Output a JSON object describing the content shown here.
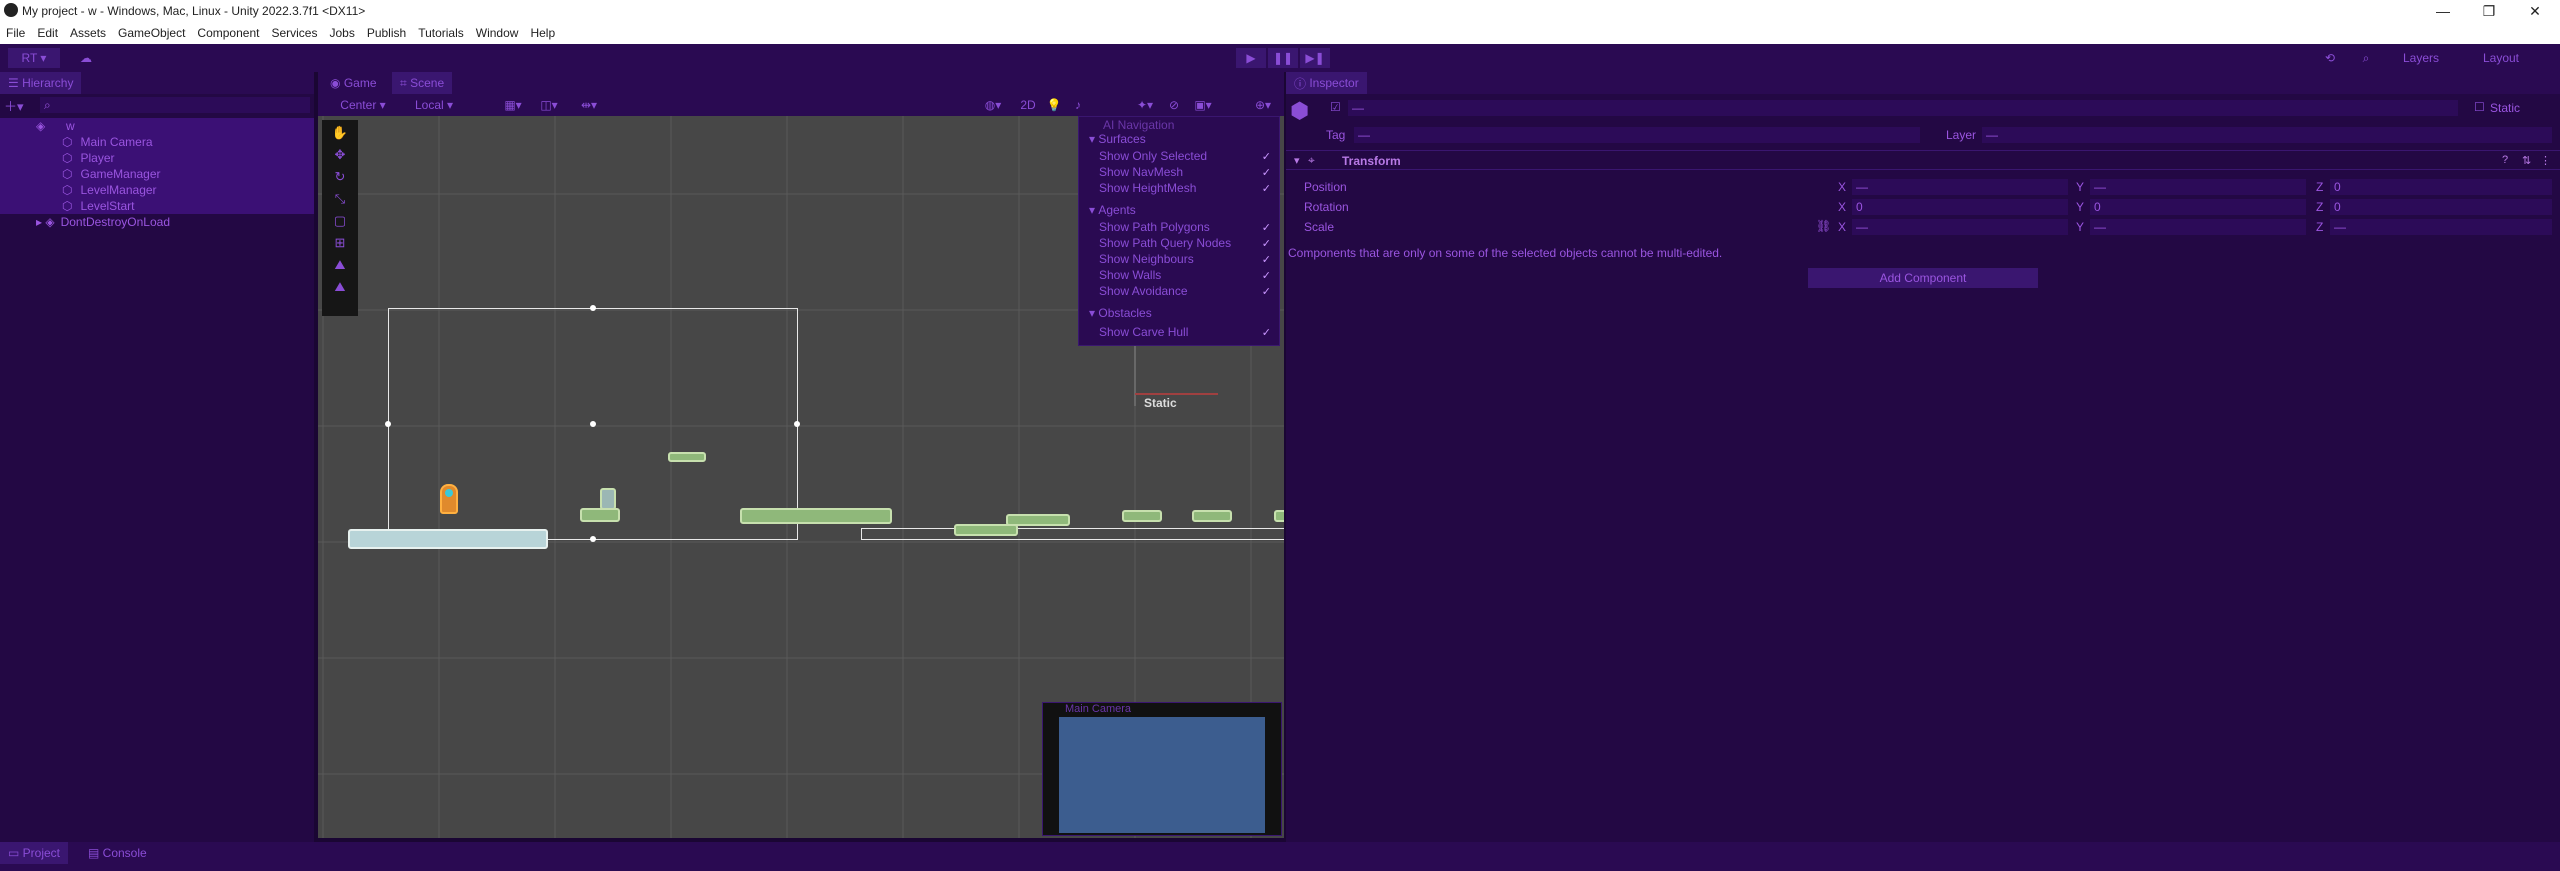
{
  "window": {
    "title": "My project - w - Windows, Mac, Linux - Unity 2022.3.7f1 <DX11>",
    "minimize": "—",
    "maximize": "❐",
    "close": "✕"
  },
  "menu": [
    "File",
    "Edit",
    "Assets",
    "GameObject",
    "Component",
    "Services",
    "Jobs",
    "Publish",
    "Tutorials",
    "Window",
    "Help"
  ],
  "toolbar": {
    "account": "RT ▾",
    "layers": "Layers",
    "layout": "Layout"
  },
  "hierarchy": {
    "tab": "Hierarchy",
    "items": [
      {
        "label": "w",
        "indent": 0,
        "selected": true
      },
      {
        "label": "Main Camera",
        "indent": 1,
        "selected": true
      },
      {
        "label": "Player",
        "indent": 1,
        "selected": true
      },
      {
        "label": "GameManager",
        "indent": 1,
        "selected": true
      },
      {
        "label": "LevelManager",
        "indent": 1,
        "selected": true
      },
      {
        "label": "LevelStart",
        "indent": 1,
        "selected": true
      },
      {
        "label": "DontDestroyOnLoad",
        "indent": 0,
        "selected": false
      }
    ]
  },
  "scene": {
    "tab_game": "Game",
    "tab_scene": "Scene",
    "pivot": "Center",
    "space": "Local",
    "static_label": "Static",
    "camera_preview_title": "Main Camera"
  },
  "ai_nav": {
    "title": "AI Navigation",
    "sections": [
      {
        "header": "Surfaces",
        "items": [
          "Show Only Selected",
          "Show NavMesh",
          "Show HeightMesh"
        ]
      },
      {
        "header": "Agents",
        "items": [
          "Show Path Polygons",
          "Show Path Query Nodes",
          "Show Neighbours",
          "Show Walls",
          "Show Avoidance"
        ]
      },
      {
        "header": "Obstacles",
        "items": [
          "Show Carve Hull"
        ]
      }
    ],
    "check": "✓"
  },
  "inspector": {
    "tab": "Inspector",
    "static": "Static",
    "tag_label": "Tag",
    "tag_value": "—",
    "layer_label": "Layer",
    "layer_value": "—",
    "name_value": "—",
    "component": "Transform",
    "position": {
      "label": "Position",
      "x": "—",
      "y": "—",
      "z": "0"
    },
    "rotation": {
      "label": "Rotation",
      "x": "0",
      "y": "0",
      "z": "0"
    },
    "scale": {
      "label": "Scale",
      "x": "—",
      "y": "—",
      "z": "—"
    },
    "warning": "Components that are only on some of the selected objects cannot be multi-edited.",
    "add_component": "Add Component"
  },
  "bottom": {
    "project": "Project",
    "console": "Console"
  }
}
